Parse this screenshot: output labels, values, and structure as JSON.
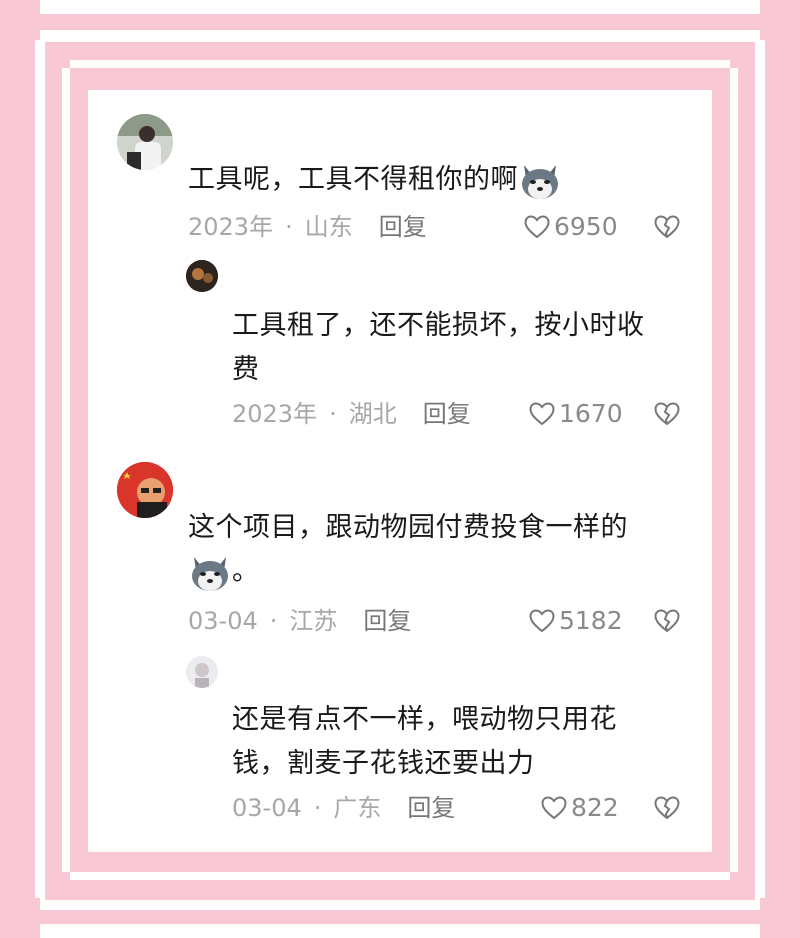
{
  "comments": [
    {
      "text": "工具呢，工具不得租你的啊",
      "emoji": "husky-emoji",
      "date": "2023年",
      "location": "山东",
      "reply_label": "回复",
      "likes": "6950",
      "replies": [
        {
          "text_line1": "工具租了，还不能损坏，按小时收",
          "text_line2": "费",
          "date": "2023年",
          "location": "湖北",
          "reply_label": "回复",
          "likes": "1670"
        }
      ]
    },
    {
      "text": "这个项目，跟动物园付费投食一样的",
      "text_tail": "。",
      "emoji": "husky-emoji",
      "date": "03-04",
      "location": "江苏",
      "reply_label": "回复",
      "likes": "5182",
      "replies": [
        {
          "text_line1": "还是有点不一样，喂动物只用花",
          "text_line2": "钱，割麦子花钱还要出力",
          "date": "03-04",
          "location": "广东",
          "reply_label": "回复",
          "likes": "822"
        }
      ]
    }
  ],
  "colors": {
    "background": "#f8c9d5",
    "text": "#1a1a1a",
    "meta": "#a7a7a7"
  },
  "icons": {
    "like": "heart-icon",
    "dislike": "broken-heart-icon",
    "emoji": "husky-emoji"
  }
}
